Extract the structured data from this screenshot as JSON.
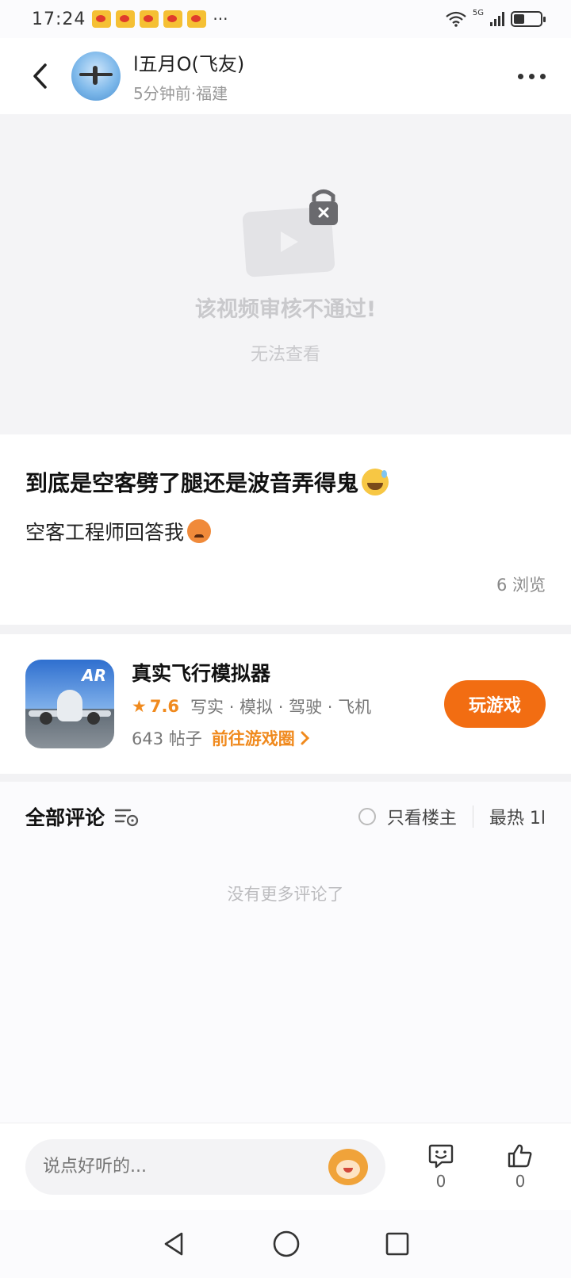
{
  "status_bar": {
    "time": "17:24",
    "more": "···",
    "network": "5G"
  },
  "header": {
    "username": "l五月O(飞友)",
    "meta": "5分钟前·福建"
  },
  "video": {
    "blocked_title": "该视频审核不通过!",
    "blocked_sub": "无法查看"
  },
  "post": {
    "title": "到底是空客劈了腿还是波音弄得鬼",
    "text": "空客工程师回答我",
    "views": "6 浏览"
  },
  "game": {
    "name": "真实飞行模拟器",
    "rating": "7.6",
    "tags": "写实 · 模拟 · 驾驶 · 飞机",
    "posts": "643 帖子",
    "goto": "前往游戏圈",
    "play": "玩游戏"
  },
  "comments": {
    "title": "全部评论",
    "op_only": "只看楼主",
    "sort": "最热 1l",
    "empty": "没有更多评论了"
  },
  "bottom": {
    "placeholder": "说点好听的...",
    "comment_count": "0",
    "like_count": "0"
  },
  "colors": {
    "accent": "#f26d12",
    "rating": "#f08a1e"
  }
}
